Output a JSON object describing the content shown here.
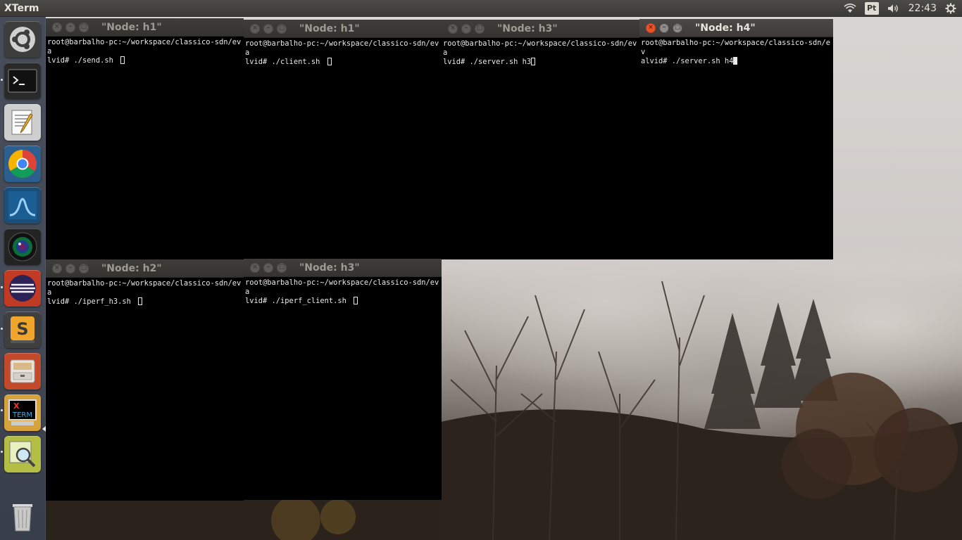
{
  "panel": {
    "app_title": "XTerm",
    "keyboard_layout": "Pt",
    "clock": "22:43",
    "icons": [
      "wifi-icon",
      "keyboard-layout-icon",
      "volume-icon",
      "settings-gear-icon"
    ]
  },
  "launcher": {
    "items": [
      {
        "name": "ubuntu-dash",
        "icon": "ubuntu-logo-icon",
        "color": "#3d3d3d"
      },
      {
        "name": "terminal",
        "icon": "terminal-icon",
        "color": "#3a3a3a"
      },
      {
        "name": "text-editor",
        "icon": "text-editor-icon",
        "color": "#d8d8d8"
      },
      {
        "name": "chrome",
        "icon": "chrome-icon",
        "color": "#2b6ea3"
      },
      {
        "name": "wireshark",
        "icon": "wireshark-fin-icon",
        "color": "#1b4f7a"
      },
      {
        "name": "webcam",
        "icon": "camera-lens-icon",
        "color": "#2a2a2a"
      },
      {
        "name": "eclipse",
        "icon": "eclipse-icon",
        "color": "#c53d28"
      },
      {
        "name": "sublime-text",
        "icon": "sublime-text-icon",
        "color": "#e7a23a"
      },
      {
        "name": "files",
        "icon": "file-cabinet-icon",
        "color": "#c04a2b"
      },
      {
        "name": "xterm",
        "icon": "xterm-icon",
        "color": "#d6a23b"
      },
      {
        "name": "image-viewer",
        "icon": "magnifier-icon",
        "color": "#b8c24a"
      },
      {
        "name": "trash",
        "icon": "trash-icon",
        "color": "#5b6170"
      }
    ]
  },
  "windows": [
    {
      "id": "w1",
      "title": "\"Node: h1\"",
      "line1": "root@barbalho-pc:~/workspace/classico-sdn/eva",
      "line2": "lvid# ./send.sh "
    },
    {
      "id": "w2",
      "title": "\"Node: h1\"",
      "line1": "root@barbalho-pc:~/workspace/classico-sdn/eva",
      "line2": "lvid# ./client.sh "
    },
    {
      "id": "w3",
      "title": "\"Node: h3\"",
      "line1": "root@barbalho-pc:~/workspace/classico-sdn/eva",
      "line2": "lvid# ./server.sh h3"
    },
    {
      "id": "w4",
      "title": "\"Node: h4\"",
      "line1": "root@barbalho-pc:~/workspace/classico-sdn/ev",
      "line2": "alvid# ./server.sh h4"
    },
    {
      "id": "w5",
      "title": "\"Node: h2\"",
      "line1": "root@barbalho-pc:~/workspace/classico-sdn/eva",
      "line2": "lvid# ./iperf_h3.sh "
    },
    {
      "id": "w6",
      "title": "\"Node: h3\"",
      "line1": "root@barbalho-pc:~/workspace/classico-sdn/eva",
      "line2": "lvid# ./iperf_client.sh "
    }
  ],
  "window_buttons": {
    "close": "×",
    "minimize": "–",
    "maximize": "□"
  },
  "colors": {
    "panel": "#3c3b37",
    "launcher": "#3a404e",
    "close_active": "#e9542a",
    "terminal_bg": "#000000",
    "terminal_fg": "#e9e9e9"
  }
}
